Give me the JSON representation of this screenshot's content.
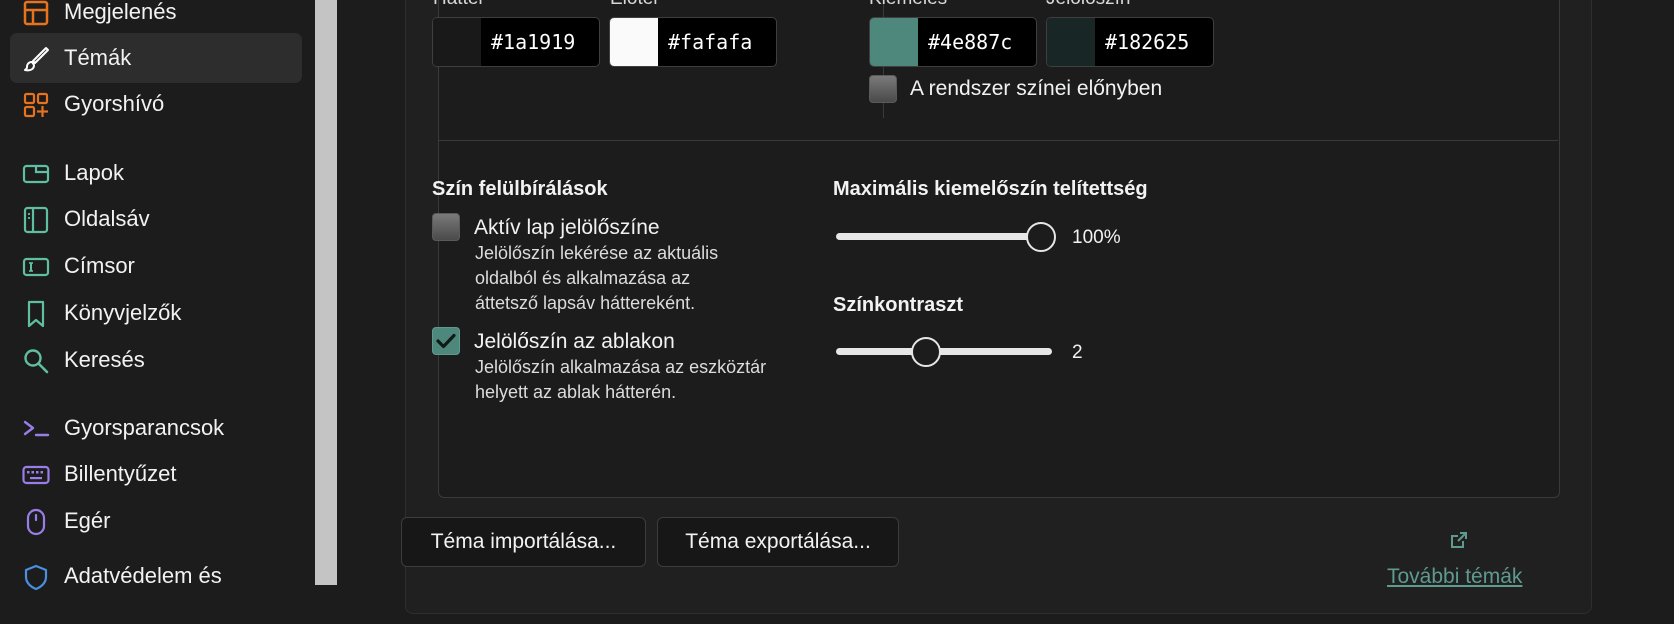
{
  "sidebar": {
    "items": [
      {
        "label": "Megjelenés",
        "icon": "appearance-icon",
        "color": "#e8731c"
      },
      {
        "label": "Témák",
        "icon": "brush-icon",
        "color": "#ffffff",
        "active": true
      },
      {
        "label": "Gyorshívó",
        "icon": "speed-dial-icon",
        "color": "#e8731c"
      },
      {
        "label": "Lapok",
        "icon": "tabs-icon",
        "color": "#5fbfa0"
      },
      {
        "label": "Oldalsáv",
        "icon": "sidebar-icon",
        "color": "#5fbfa0"
      },
      {
        "label": "Címsor",
        "icon": "address-bar-icon",
        "color": "#5fbfa0"
      },
      {
        "label": "Könyvjelzők",
        "icon": "bookmark-icon",
        "color": "#5fbfa0"
      },
      {
        "label": "Keresés",
        "icon": "search-icon",
        "color": "#5fbfa0"
      },
      {
        "label": "Gyorsparancsok",
        "icon": "quick-commands-icon",
        "color": "#9a7de8"
      },
      {
        "label": "Billentyűzet",
        "icon": "keyboard-icon",
        "color": "#9a7de8"
      },
      {
        "label": "Egér",
        "icon": "mouse-icon",
        "color": "#9a7de8"
      },
      {
        "label": "Adatvédelem és",
        "icon": "privacy-shield-icon",
        "color": "#4a90e2"
      }
    ]
  },
  "colors": {
    "background": {
      "label": "Háttér",
      "hex": "#1a1919"
    },
    "foreground": {
      "label": "Előtér",
      "hex": "#fafafa"
    },
    "highlight": {
      "label": "Kiemelés",
      "hex": "#4e887c"
    },
    "accent": {
      "label": "Jelölőszín",
      "hex": "#182625"
    },
    "prefer_system": {
      "label": "A rendszer színei előnyben",
      "checked": false
    }
  },
  "overrides": {
    "title": "Szín felülbírálások",
    "active_tab_accent": {
      "label": "Aktív lap jelölőszíne",
      "description": [
        "Jelölőszín lekérése az aktuális",
        "oldalból és alkalmazása az",
        "áttetsző lapsáv háttereként."
      ],
      "checked": false
    },
    "window_accent": {
      "label": "Jelölőszín az ablakon",
      "description": [
        "Jelölőszín alkalmazása az eszköztár",
        "helyett az ablak hátterén."
      ],
      "checked": true
    }
  },
  "saturation": {
    "title": "Maximális kiemelőszín telítettség",
    "value_text": "100%",
    "value": 1.0
  },
  "contrast": {
    "title": "Színkontraszt",
    "value_text": "2",
    "value": 0.4
  },
  "footer": {
    "import_label": "Téma importálása...",
    "export_label": "Téma exportálása...",
    "more_themes_label": "További témák"
  }
}
